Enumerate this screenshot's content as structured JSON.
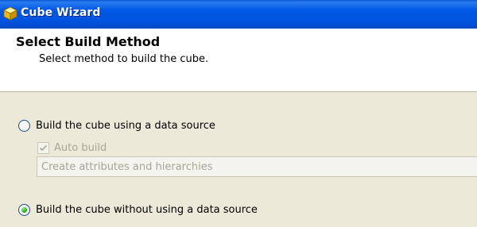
{
  "window": {
    "title": "Cube Wizard",
    "icon": "cube-icon"
  },
  "header": {
    "title": "Select Build Method",
    "subtitle": "Select method to build the cube."
  },
  "options": {
    "with_source": {
      "label": "Build the cube using a data source",
      "selected": false
    },
    "auto_build": {
      "label": "Auto build",
      "checked": true,
      "enabled": false
    },
    "auto_build_mode": {
      "value": "Create attributes and hierarchies",
      "enabled": false
    },
    "without_source": {
      "label": "Build the cube without using a data source",
      "selected": true
    }
  },
  "colors": {
    "titlebar": "#0055e0",
    "body": "#ece9d8",
    "header": "#ffffff",
    "radio_dot": "#28b928",
    "disabled_text": "#a8a595"
  }
}
